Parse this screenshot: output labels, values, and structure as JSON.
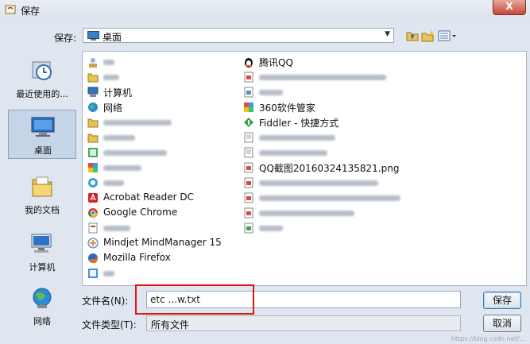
{
  "window": {
    "title": "保存",
    "close_glyph": "X"
  },
  "look_in": {
    "label": "保存:",
    "value": "桌面",
    "icon": "desktop-icon"
  },
  "toolbar": {
    "icons": [
      "up-one-level-icon",
      "create-new-folder-icon",
      "view-menu-icon"
    ]
  },
  "places": [
    {
      "label": "最近使用的...",
      "icon": "recent-items-icon",
      "selected": false
    },
    {
      "label": "桌面",
      "icon": "desktop-icon",
      "selected": true
    },
    {
      "label": "我的文档",
      "icon": "documents-icon",
      "selected": false
    },
    {
      "label": "计算机",
      "icon": "computer-icon",
      "selected": false
    },
    {
      "label": "网络",
      "icon": "network-icon",
      "selected": false
    }
  ],
  "files": {
    "left": [
      {
        "label": "",
        "icon": "user-folder-icon",
        "blurred": true
      },
      {
        "label": "",
        "icon": "folder-icon",
        "blurred": true
      },
      {
        "label": "计算机",
        "icon": "computer-icon"
      },
      {
        "label": "网络",
        "icon": "network-icon"
      },
      {
        "label": "",
        "icon": "folder-icon",
        "blurred": true
      },
      {
        "label": "",
        "icon": "folder-icon",
        "blurred": true
      },
      {
        "label": "",
        "icon": "shortcut-icon",
        "blurred": true
      },
      {
        "label": "",
        "icon": "shortcut-icon",
        "blurred": true
      },
      {
        "label": "",
        "icon": "shortcut-icon",
        "blurred": true
      },
      {
        "label": "Acrobat Reader DC",
        "icon": "acrobat-icon"
      },
      {
        "label": "Google Chrome",
        "icon": "chrome-icon"
      },
      {
        "label": "",
        "icon": "shortcut-icon",
        "blurred": true
      },
      {
        "label": "Mindjet MindManager 15",
        "icon": "mindmanager-icon"
      },
      {
        "label": "Mozilla Firefox",
        "icon": "firefox-icon"
      },
      {
        "label": "",
        "icon": "shortcut-icon",
        "blurred": true
      }
    ],
    "right": [
      {
        "label": "腾讯QQ",
        "icon": "qq-penguin-icon"
      },
      {
        "label": "",
        "icon": "image-file-icon",
        "blurred": true
      },
      {
        "label": "",
        "icon": "image-file-icon",
        "blurred": true
      },
      {
        "label": "360软件管家",
        "icon": "360-software-icon"
      },
      {
        "label": "Fiddler - 快捷方式",
        "icon": "fiddler-icon"
      },
      {
        "label": "",
        "icon": "text-file-icon",
        "blurred": true
      },
      {
        "label": "",
        "icon": "text-file-icon",
        "blurred": true
      },
      {
        "label": "QQ截图20160324135821.png",
        "icon": "image-file-icon"
      },
      {
        "label": "",
        "icon": "image-file-icon",
        "blurred": true
      },
      {
        "label": "",
        "icon": "image-file-icon",
        "blurred": true
      },
      {
        "label": "",
        "icon": "image-file-icon",
        "blurred": true
      },
      {
        "label": "",
        "icon": "image-file-icon",
        "blurred": true
      }
    ]
  },
  "file_name": {
    "label": "文件名(N):",
    "value": "etc ...w.txt"
  },
  "file_type": {
    "label": "文件类型(T):",
    "value": "所有文件"
  },
  "buttons": {
    "save": "保存",
    "cancel": "取消"
  },
  "watermark": "https://blog.csdn.net/...",
  "colors": {
    "highlight": "#e01515",
    "title_bar": "#dbe3ec",
    "selection": "#c5d4e6"
  }
}
